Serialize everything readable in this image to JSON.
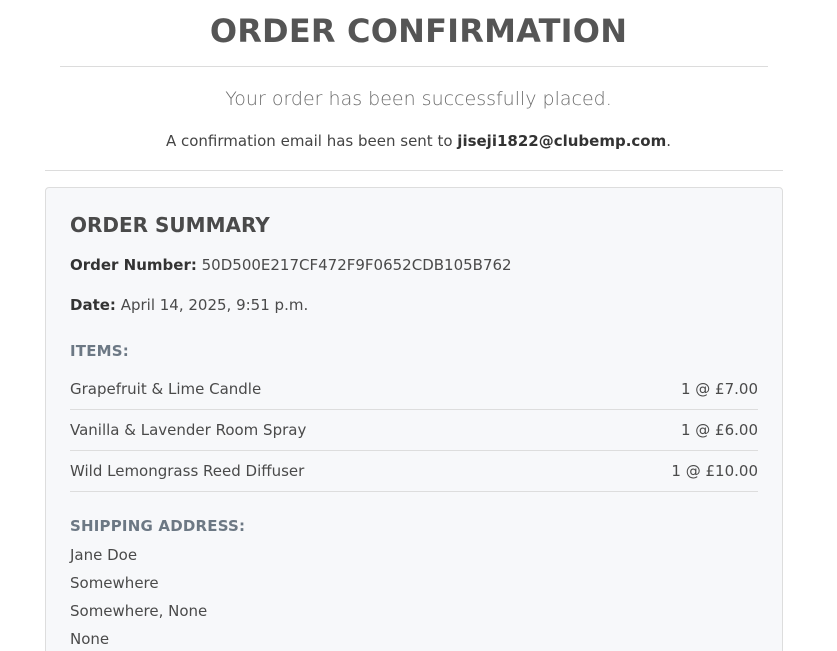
{
  "header": {
    "title": "ORDER CONFIRMATION",
    "subtitle": "Your order has been successfully placed.",
    "email_prefix": "A confirmation email has been sent to ",
    "email": "jiseji1822@clubemp.com",
    "email_suffix": "."
  },
  "summary": {
    "title": "ORDER SUMMARY",
    "order_number_label": "Order Number:",
    "order_number": "50D500E217CF472F9F0652CDB105B762",
    "date_label": "Date:",
    "date": "April 14, 2025, 9:51 p.m.",
    "items_label": "ITEMS:",
    "items": [
      {
        "name": "Grapefruit & Lime Candle",
        "qty_price": "1 @ £7.00"
      },
      {
        "name": "Vanilla & Lavender Room Spray",
        "qty_price": "1 @ £6.00"
      },
      {
        "name": "Wild Lemongrass Reed Diffuser",
        "qty_price": "1 @ £10.00"
      }
    ],
    "shipping_label": "SHIPPING ADDRESS:",
    "address": [
      "Jane Doe",
      "Somewhere",
      "Somewhere, None",
      "None"
    ]
  }
}
